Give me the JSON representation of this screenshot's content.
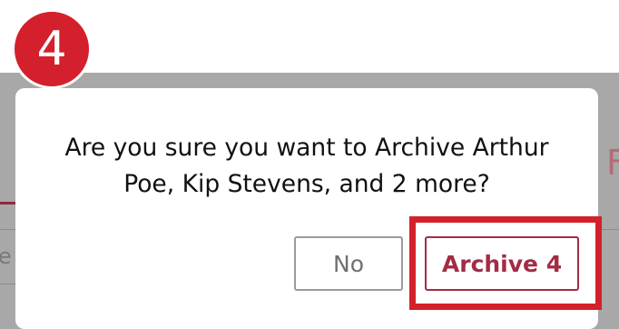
{
  "step_badge": {
    "number": "4"
  },
  "background": {
    "right_fragment": "F",
    "left_fragment": "e"
  },
  "dialog": {
    "message_line1": "Are you sure you want to Archive Arthur",
    "message_line2": "Poe, Kip Stevens, and 2 more?",
    "no_label": "No",
    "archive_label": "Archive 4"
  },
  "colors": {
    "accent": "#a32c45",
    "highlight": "#d4202c",
    "overlay": "#a8a8a8"
  }
}
